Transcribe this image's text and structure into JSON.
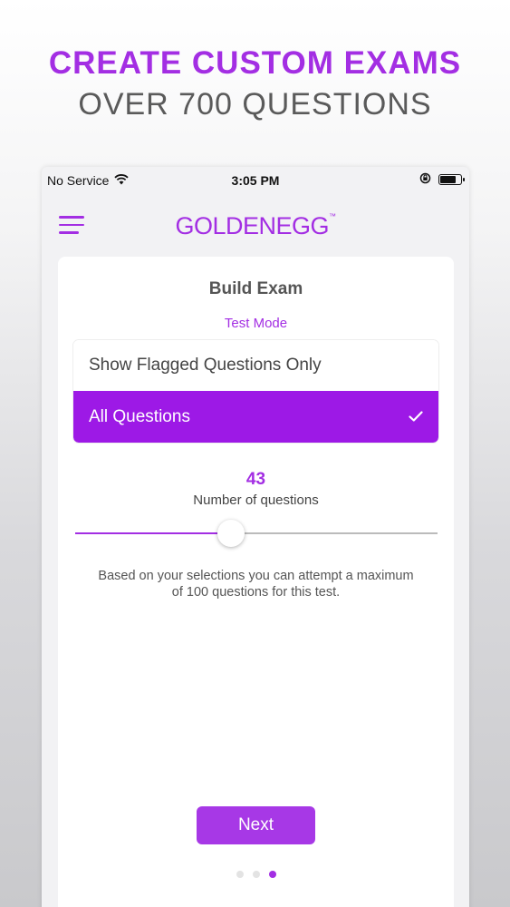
{
  "promo": {
    "title": "CREATE CUSTOM EXAMS",
    "subtitle": "OVER 700 QUESTIONS"
  },
  "status_bar": {
    "carrier": "No Service",
    "time": "3:05 PM",
    "battery_level": 0.75,
    "icons": [
      "wifi-icon",
      "rotation-lock-icon",
      "battery-icon"
    ]
  },
  "nav": {
    "logo": "GOLDENEGG",
    "logo_tm": "™",
    "menu_icon": "hamburger-menu-icon"
  },
  "build_exam": {
    "title": "Build Exam",
    "test_mode_label": "Test Mode",
    "options": [
      {
        "label": "Show Flagged Questions Only",
        "selected": false
      },
      {
        "label": "All Questions",
        "selected": true,
        "check": "✓"
      }
    ],
    "question_count": "43",
    "question_count_label": "Number of questions",
    "slider_value": 43,
    "slider_max": 100,
    "info_text": "Based on your selections you can attempt a maximum of 100 questions for this test.",
    "next_label": "Next"
  },
  "pagination": {
    "total": 3,
    "active": 3
  },
  "colors": {
    "accent": "#a32ee3",
    "selected_option": "#9d19e6",
    "button": "#a738e6"
  }
}
